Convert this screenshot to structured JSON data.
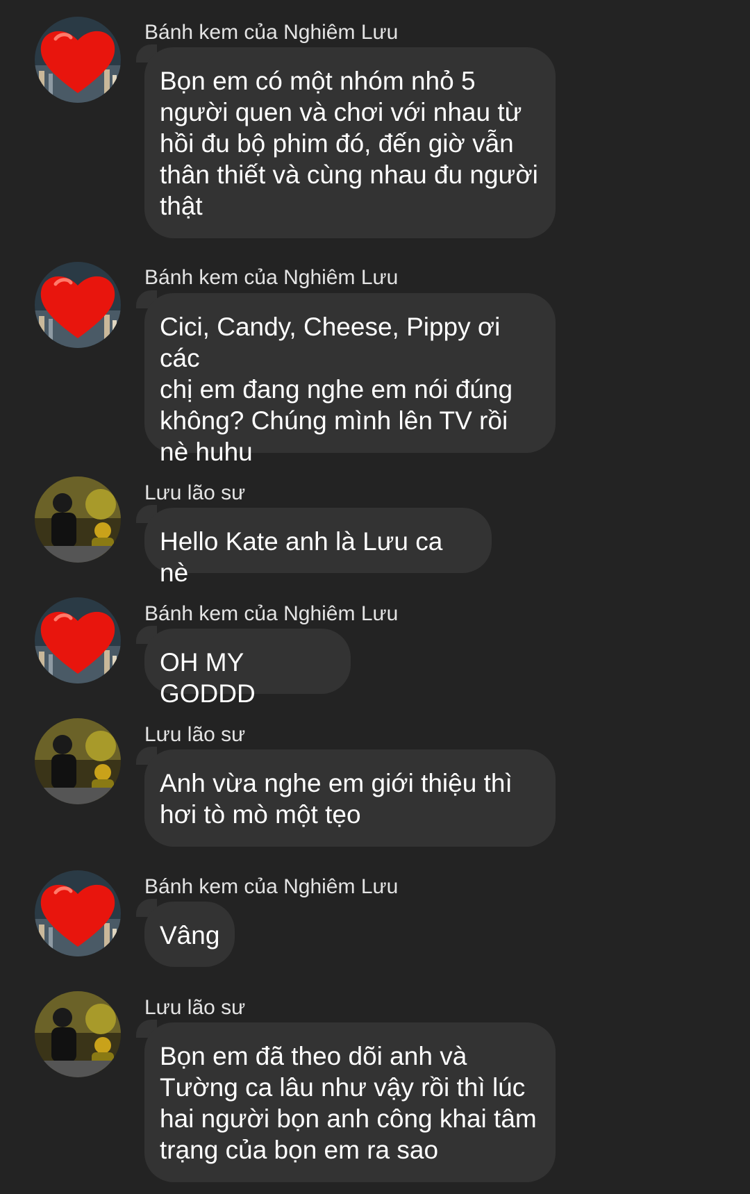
{
  "messages": [
    {
      "sender": "Bánh kem của Nghiêm Lưu",
      "avatar": "heart-avatar",
      "text": "Bọn em có một nhóm nhỏ 5\nngười quen và chơi với nhau từ\nhồi đu bộ phim đó, đến giờ vẫn\nthân thiết và cùng nhau đu người\nthật"
    },
    {
      "sender": "Bánh kem của Nghiêm Lưu",
      "avatar": "heart-avatar",
      "text": "Cici, Candy, Cheese, Pippy ơi các\nchị em đang nghe em nói đúng\nkhông? Chúng mình lên TV rồi\nnè huhu"
    },
    {
      "sender": "Lưu lão sư",
      "avatar": "person-photo-avatar",
      "text": "Hello Kate anh là Lưu ca nè"
    },
    {
      "sender": "Bánh kem của Nghiêm Lưu",
      "avatar": "heart-avatar",
      "text": "OH MY GODDD"
    },
    {
      "sender": "Lưu lão sư",
      "avatar": "person-photo-avatar",
      "text": "Anh vừa nghe em giới thiệu thì\nhơi tò mò một tẹo"
    },
    {
      "sender": "Bánh kem của Nghiêm Lưu",
      "avatar": "heart-avatar",
      "text": "Vâng"
    },
    {
      "sender": "Lưu lão sư",
      "avatar": "person-photo-avatar",
      "text": "Bọn em đã theo dõi anh và\nTường ca lâu như vậy rồi thì lúc\nhai người bọn anh công khai tâm\ntrạng của bọn em ra sao"
    }
  ],
  "colors": {
    "background": "#232323",
    "bubble": "#333333",
    "sender_text": "#e4e4e4",
    "message_text": "#ffffff"
  }
}
